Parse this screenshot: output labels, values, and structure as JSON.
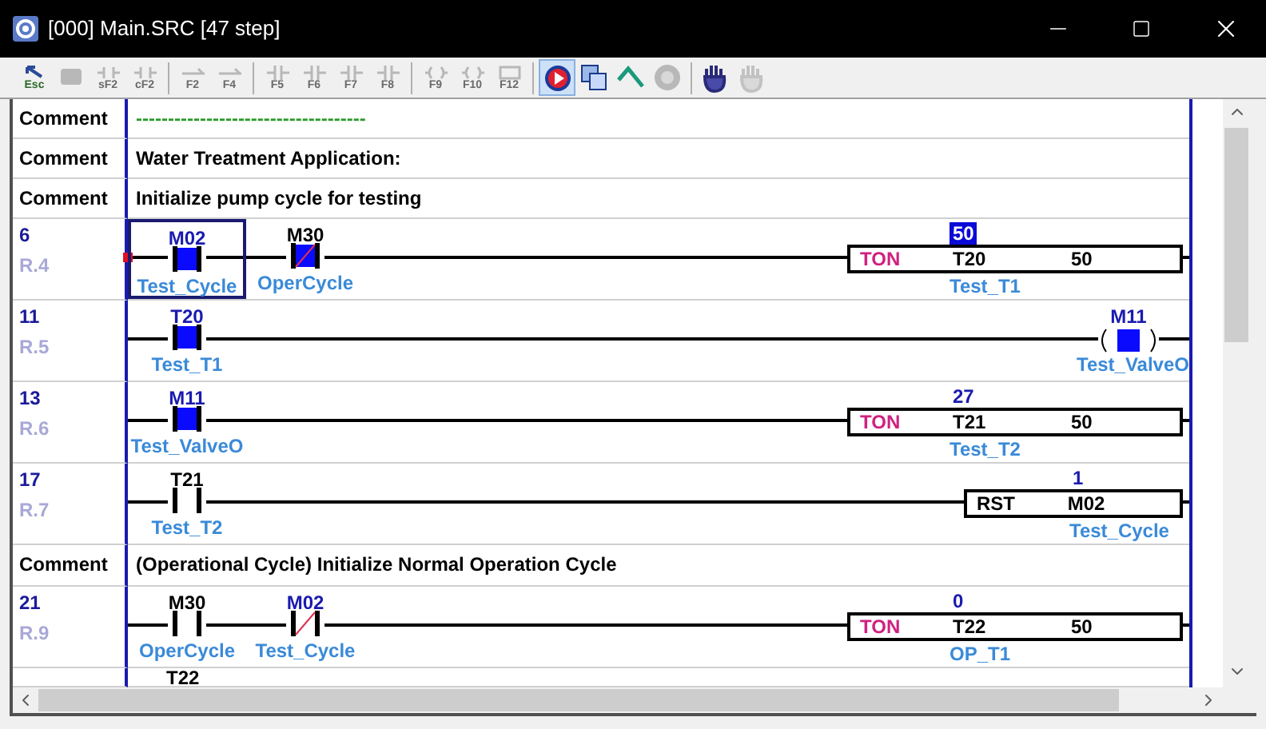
{
  "window": {
    "title": "[000] Main.SRC [47 step]"
  },
  "toolbar": [
    {
      "kind": "cursor",
      "label": "Esc",
      "disabled": false,
      "selected": false
    },
    {
      "kind": "bubble",
      "disabled": true,
      "selected": false
    },
    {
      "kind": "contact-wire",
      "label": "sF2",
      "disabled": true,
      "selected": false
    },
    {
      "kind": "contact-wire",
      "label": "cF2",
      "disabled": true,
      "selected": false
    },
    {
      "kind": "separator"
    },
    {
      "kind": "wire",
      "label": "F2",
      "disabled": true,
      "selected": false
    },
    {
      "kind": "wire",
      "label": "F4",
      "disabled": true,
      "selected": false
    },
    {
      "kind": "separator"
    },
    {
      "kind": "contact",
      "label": "F5",
      "disabled": true,
      "selected": false
    },
    {
      "kind": "contact",
      "label": "F6",
      "disabled": true,
      "selected": false
    },
    {
      "kind": "contact",
      "label": "F7",
      "disabled": true,
      "selected": false
    },
    {
      "kind": "contact",
      "label": "F8",
      "disabled": true,
      "selected": false
    },
    {
      "kind": "separator"
    },
    {
      "kind": "coil",
      "label": "F9",
      "disabled": true,
      "selected": false
    },
    {
      "kind": "coil",
      "label": "F10",
      "disabled": true,
      "selected": false
    },
    {
      "kind": "box",
      "label": "F12",
      "disabled": true,
      "selected": false
    },
    {
      "kind": "separator"
    },
    {
      "kind": "run",
      "disabled": false,
      "selected": true
    },
    {
      "kind": "copy",
      "disabled": false,
      "selected": false
    },
    {
      "kind": "check",
      "disabled": false,
      "selected": false
    },
    {
      "kind": "circle",
      "disabled": true,
      "selected": false
    },
    {
      "kind": "separator"
    },
    {
      "kind": "hand",
      "disabled": false,
      "selected": false
    },
    {
      "kind": "hand",
      "disabled": true,
      "selected": false
    }
  ],
  "rows": [
    {
      "kind": "comment",
      "label": "Comment",
      "text": "------------------------------------",
      "color": "#2a9a2a"
    },
    {
      "kind": "comment",
      "label": "Comment",
      "text": "Water Treatment Application:",
      "color": "#000000"
    },
    {
      "kind": "comment",
      "label": "Comment",
      "text": "Initialize pump cycle for testing",
      "color": "#000000"
    },
    {
      "kind": "rung",
      "step": "6",
      "ref": "R.4",
      "cursor": true,
      "contacts": [
        {
          "address": "M02",
          "label": "Test_Cycle",
          "on": true,
          "powered": true,
          "negated": false,
          "selected": true
        },
        {
          "address": "M30",
          "label": "OperCycle",
          "on": false,
          "powered": true,
          "negated": true,
          "selected": false
        }
      ],
      "output": {
        "kind": "ton",
        "op": "TON",
        "address": "T20",
        "preset": "50",
        "value": "50",
        "done": true,
        "label": "Test_T1"
      }
    },
    {
      "kind": "rung",
      "step": "11",
      "ref": "R.5",
      "cursor": false,
      "contacts": [
        {
          "address": "T20",
          "label": "Test_T1",
          "on": true,
          "powered": true,
          "negated": false,
          "selected": false
        }
      ],
      "output": {
        "kind": "coil",
        "address": "M11",
        "label": "Test_ValveO",
        "on": true
      }
    },
    {
      "kind": "rung",
      "step": "13",
      "ref": "R.6",
      "cursor": false,
      "contacts": [
        {
          "address": "M11",
          "label": "Test_ValveO",
          "on": true,
          "powered": true,
          "negated": false,
          "selected": false
        }
      ],
      "output": {
        "kind": "ton",
        "op": "TON",
        "address": "T21",
        "preset": "50",
        "value": "27",
        "done": false,
        "label": "Test_T2"
      }
    },
    {
      "kind": "rung",
      "step": "17",
      "ref": "R.7",
      "cursor": false,
      "contacts": [
        {
          "address": "T21",
          "label": "Test_T2",
          "on": false,
          "powered": false,
          "negated": false,
          "selected": false
        }
      ],
      "output": {
        "kind": "rst",
        "op": "RST",
        "address": "M02",
        "value": "1",
        "label": "Test_Cycle"
      }
    },
    {
      "kind": "comment",
      "label": "Comment",
      "text": "(Operational Cycle) Initialize Normal Operation Cycle",
      "color": "#000000"
    },
    {
      "kind": "rung",
      "step": "21",
      "ref": "R.9",
      "cursor": false,
      "contacts": [
        {
          "address": "M30",
          "label": "OperCycle",
          "on": false,
          "powered": false,
          "negated": false,
          "selected": false
        },
        {
          "address": "M02",
          "label": "Test_Cycle",
          "on": true,
          "powered": false,
          "negated": true,
          "selected": false
        }
      ],
      "output": {
        "kind": "ton",
        "op": "TON",
        "address": "T22",
        "preset": "50",
        "value": "0",
        "done": false,
        "label": "OP_T1"
      }
    },
    {
      "kind": "partial",
      "contact": "T22"
    }
  ]
}
